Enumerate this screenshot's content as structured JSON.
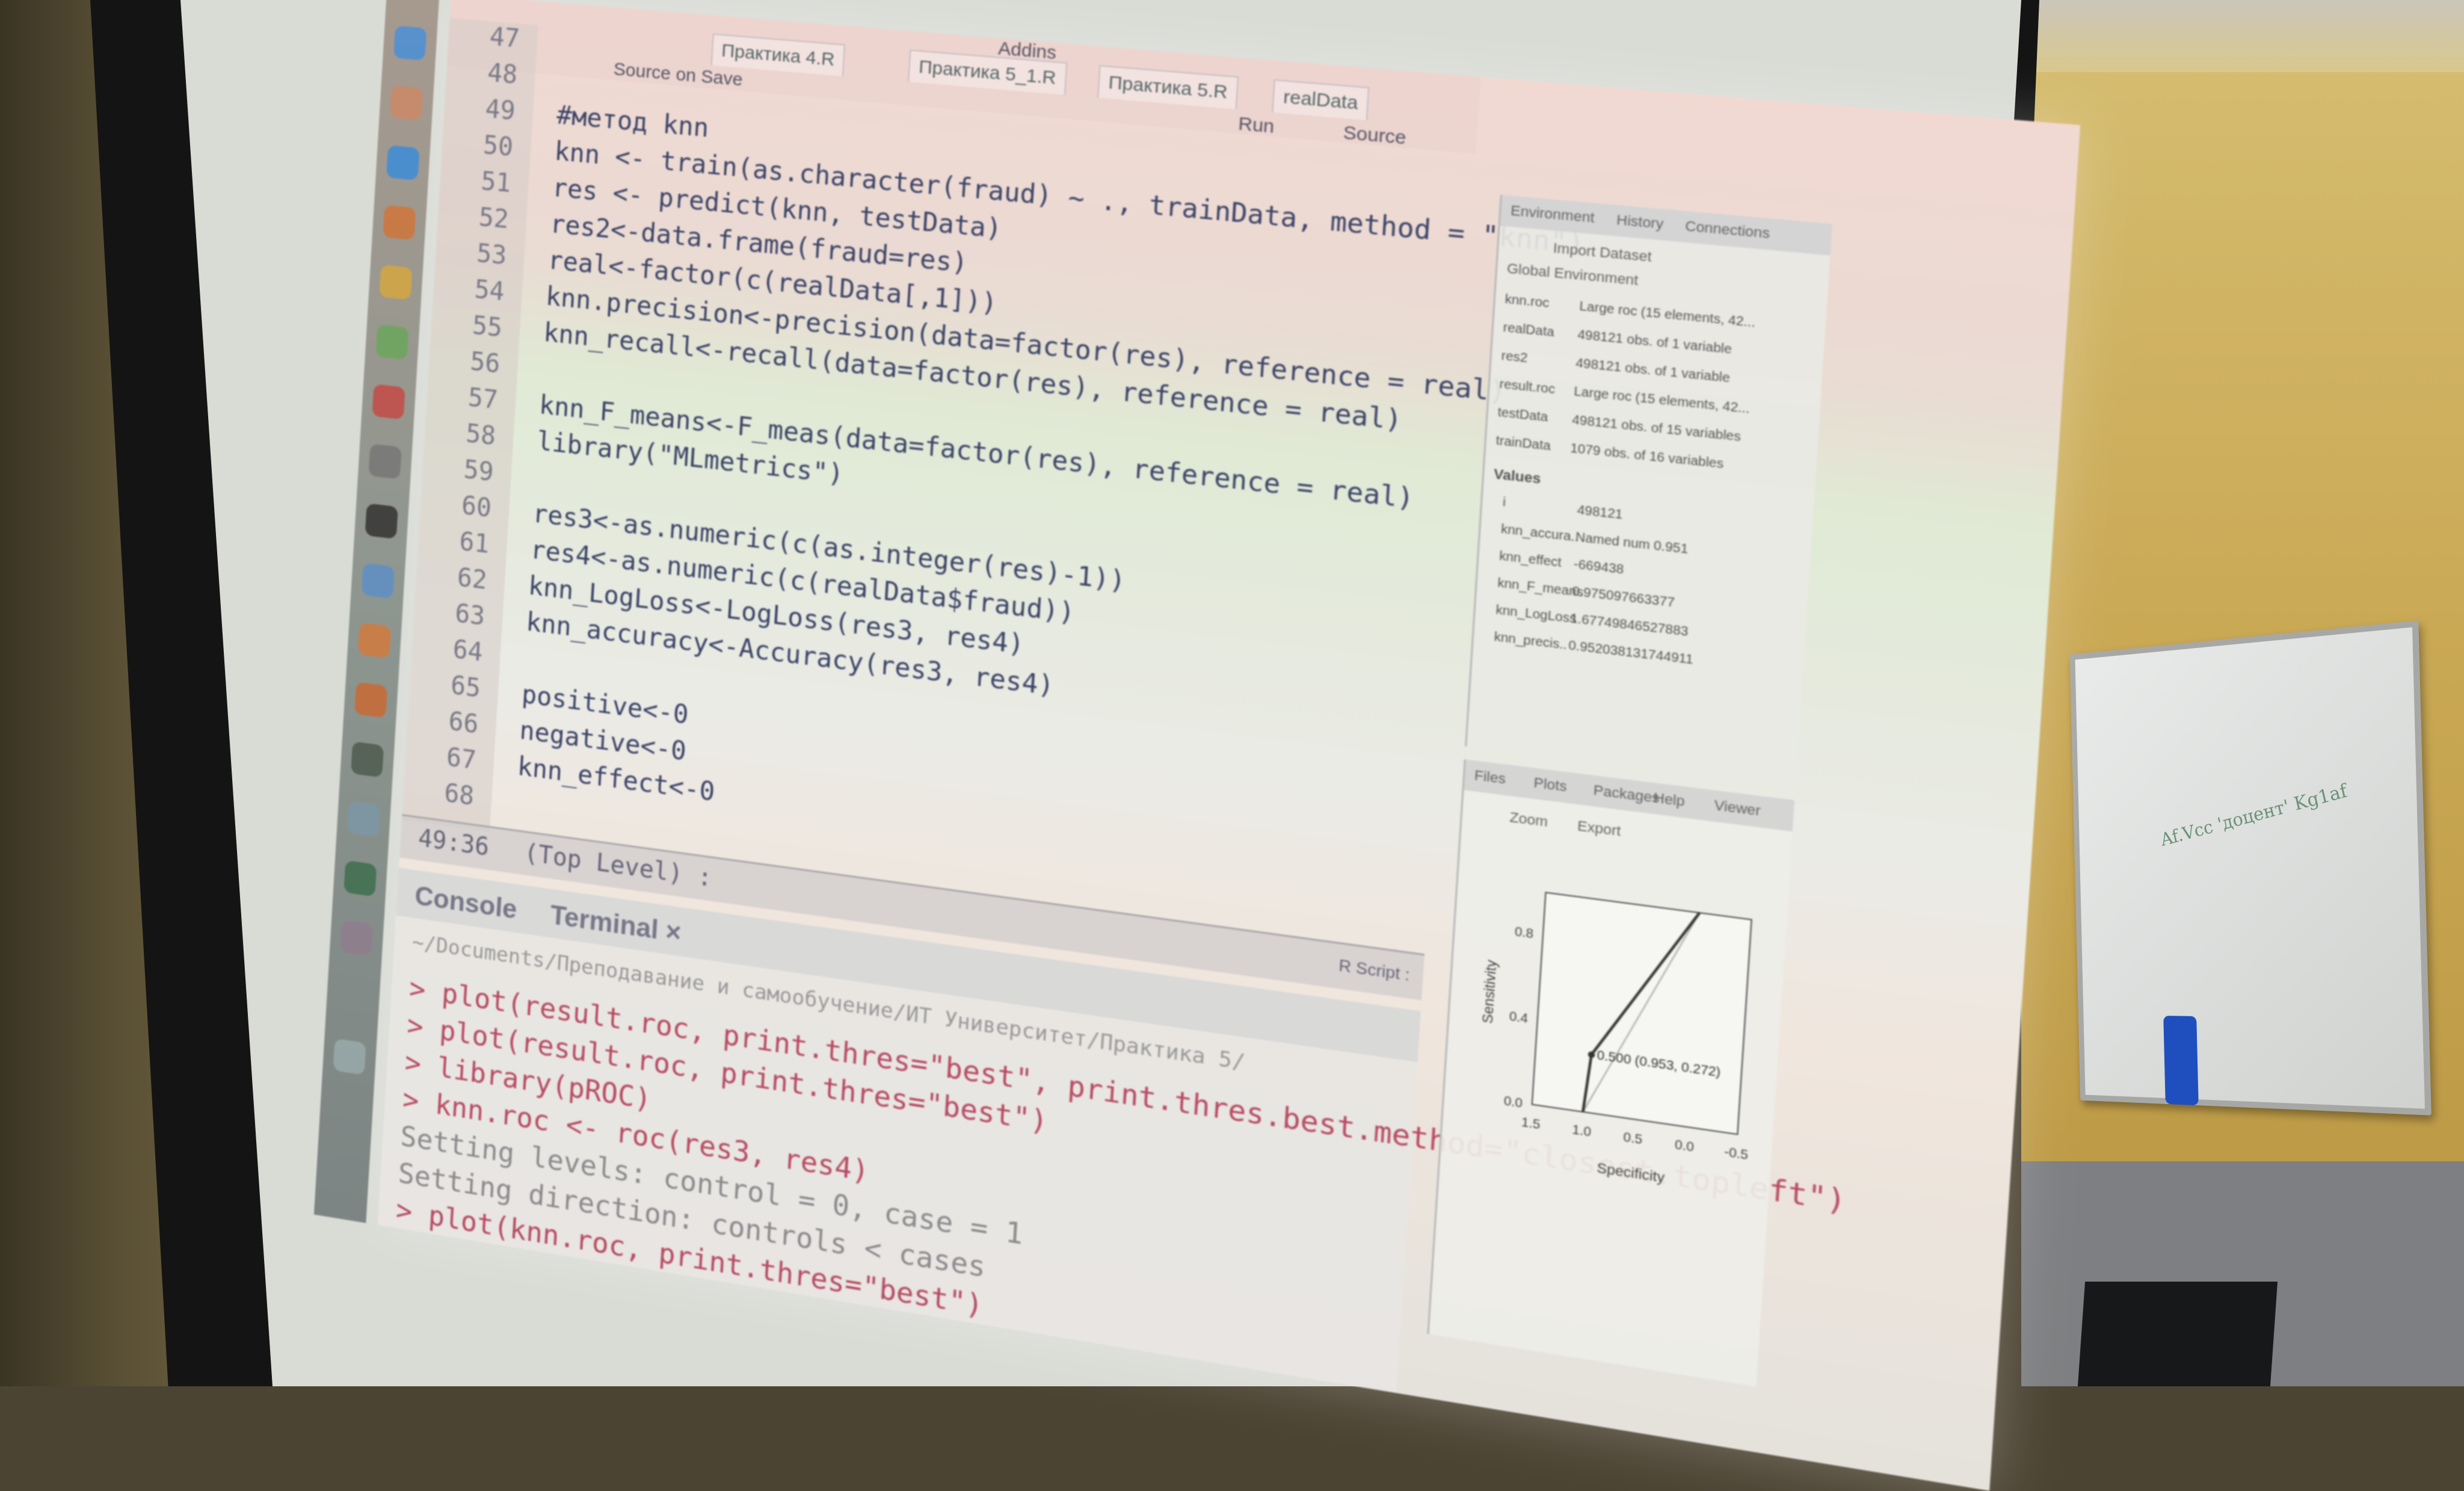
{
  "editor": {
    "tabs": [
      "Практика 4.R",
      "Практика 5_1.R",
      "Практика 5.R",
      "realData"
    ],
    "toolbar": {
      "source_on_save": "Source on Save",
      "addins": "Addins",
      "run": "Run",
      "source": "Source"
    },
    "lines": [
      {
        "n": "47",
        "text": ""
      },
      {
        "n": "48",
        "text": ""
      },
      {
        "n": "49",
        "text": "#метод knn"
      },
      {
        "n": "50",
        "text": "knn <- train(as.character(fraud) ~ ., trainData, method = \"knn\")"
      },
      {
        "n": "51",
        "text": "res <- predict(knn, testData)"
      },
      {
        "n": "52",
        "text": "res2<-data.frame(fraud=res)"
      },
      {
        "n": "53",
        "text": "real<-factor(c(realData[,1]))"
      },
      {
        "n": "54",
        "text": "knn.precision<-precision(data=factor(res), reference = real)"
      },
      {
        "n": "55",
        "text": "knn_recall<-recall(data=factor(res), reference = real)"
      },
      {
        "n": "56",
        "text": ""
      },
      {
        "n": "57",
        "text": "knn_F_means<-F_meas(data=factor(res), reference = real)"
      },
      {
        "n": "58",
        "text": "library(\"MLmetrics\")"
      },
      {
        "n": "59",
        "text": ""
      },
      {
        "n": "60",
        "text": "res3<-as.numeric(c(as.integer(res)-1))"
      },
      {
        "n": "61",
        "text": "res4<-as.numeric(c(realData$fraud))"
      },
      {
        "n": "62",
        "text": "knn_LogLoss<-LogLoss(res3, res4)"
      },
      {
        "n": "63",
        "text": "knn_accuracy<-Accuracy(res3, res4)"
      },
      {
        "n": "64",
        "text": ""
      },
      {
        "n": "65",
        "text": "positive<-0"
      },
      {
        "n": "66",
        "text": "negative<-0"
      },
      {
        "n": "67",
        "text": "knn_effect<-0"
      },
      {
        "n": "68",
        "text": ""
      }
    ],
    "status": {
      "position": "49:36",
      "scope": "(Top Level) :",
      "type": "R Script :"
    }
  },
  "console": {
    "tabs": [
      "Console",
      "Terminal ×"
    ],
    "path": "~/Documents/Преподавание и самообучение/ИТ Университет/Практика 5/",
    "lines": [
      {
        "kind": "cmd",
        "text": "> plot(result.roc, print.thres=\"best\", print.thres.best.method=\"closest.topleft\")"
      },
      {
        "kind": "cmd",
        "text": "> plot(result.roc, print.thres=\"best\")"
      },
      {
        "kind": "cmd",
        "text": "> library(pROC)"
      },
      {
        "kind": "cmd",
        "text": "> knn.roc <- roc(res3, res4)"
      },
      {
        "kind": "out",
        "text": "Setting levels: control = 0, case = 1"
      },
      {
        "kind": "out",
        "text": "Setting direction: controls < cases"
      },
      {
        "kind": "cmd",
        "text": "> plot(knn.roc, print.thres=\"best\")"
      }
    ]
  },
  "environment": {
    "tabs": [
      "Environment",
      "History",
      "Connections"
    ],
    "import_label": "Import Dataset",
    "scope": "Global Environment",
    "data": [
      {
        "name": "knn.roc",
        "value": "Large roc (15 elements, 42..."
      },
      {
        "name": "realData",
        "value": "498121 obs. of 1 variable"
      },
      {
        "name": "res2",
        "value": "498121 obs. of 1 variable"
      },
      {
        "name": "result.roc",
        "value": "Large roc (15 elements, 42..."
      },
      {
        "name": "testData",
        "value": "498121 obs. of 15 variables"
      },
      {
        "name": "trainData",
        "value": "1079 obs. of 16 variables"
      }
    ],
    "values_header": "Values",
    "values": [
      {
        "name": "i",
        "value": "498121"
      },
      {
        "name": "knn_accura..",
        "value": "Named num 0.951"
      },
      {
        "name": "knn_effect",
        "value": "-669438"
      },
      {
        "name": "knn_F_means",
        "value": "0.975097663377"
      },
      {
        "name": "knn_LogLoss",
        "value": "1.67749846527883"
      },
      {
        "name": "knn_precis..",
        "value": "0.952038131744911"
      }
    ]
  },
  "files": {
    "tabs": [
      "Files",
      "Plots",
      "Packages",
      "Help",
      "Viewer"
    ],
    "zoom_label": "Zoom",
    "export_label": "Export"
  },
  "chart_data": {
    "type": "line",
    "title": "",
    "xlabel": "Specificity",
    "ylabel": "Sensitivity",
    "x_ticks": [
      "1.5",
      "1.0",
      "0.5",
      "0.0",
      "-0.5"
    ],
    "y_ticks": [
      "0.0",
      "0.4",
      "0.8"
    ],
    "xlim": [
      1.5,
      -0.5
    ],
    "ylim": [
      0,
      1
    ],
    "series": [
      {
        "x": [
          1.0,
          0.953,
          0.0
        ],
        "y": [
          0.0,
          0.272,
          1.0
        ]
      }
    ],
    "annotation": "0.500 (0.953, 0.272)"
  },
  "room": {
    "whiteboard_text": "Af.Vcc 'доцент' Kg1af"
  }
}
